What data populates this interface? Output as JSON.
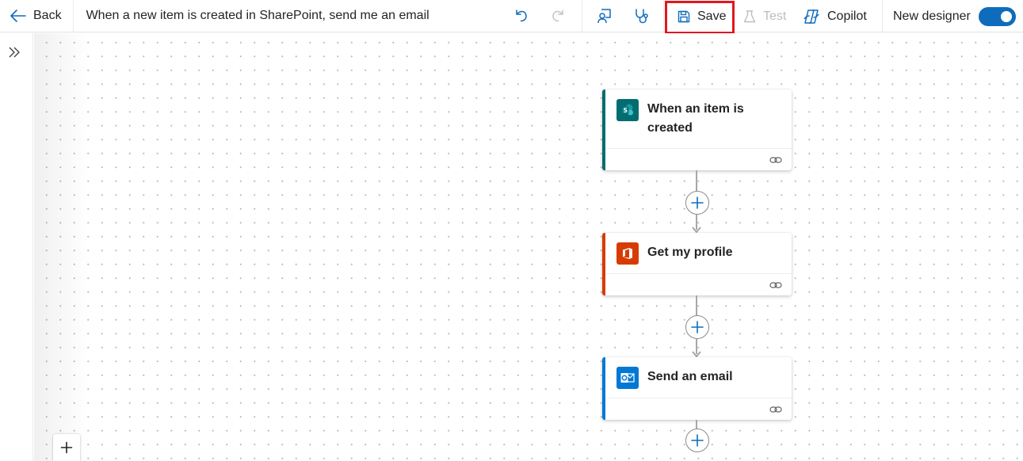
{
  "toolbar": {
    "back_label": "Back",
    "flow_title": "When a new item is created in SharePoint, send me an email",
    "undo_icon": "undo-icon",
    "redo_icon": "redo-icon",
    "flow_checker_icon": "flow-checker-icon",
    "diagnostics_icon": "stethoscope-icon",
    "save_label": "Save",
    "test_label": "Test",
    "copilot_label": "Copilot",
    "new_designer_label": "New designer",
    "new_designer_on": true,
    "accent_color": "#0f6cbd",
    "highlight_color": "#e0181f"
  },
  "canvas": {
    "steps": [
      {
        "title": "When an item is created",
        "icon": "sharepoint-icon",
        "accent": "#036c70"
      },
      {
        "title": "Get my profile",
        "icon": "office365-icon",
        "accent": "#d83b01"
      },
      {
        "title": "Send an email",
        "icon": "outlook-icon",
        "accent": "#0078d4"
      }
    ]
  }
}
